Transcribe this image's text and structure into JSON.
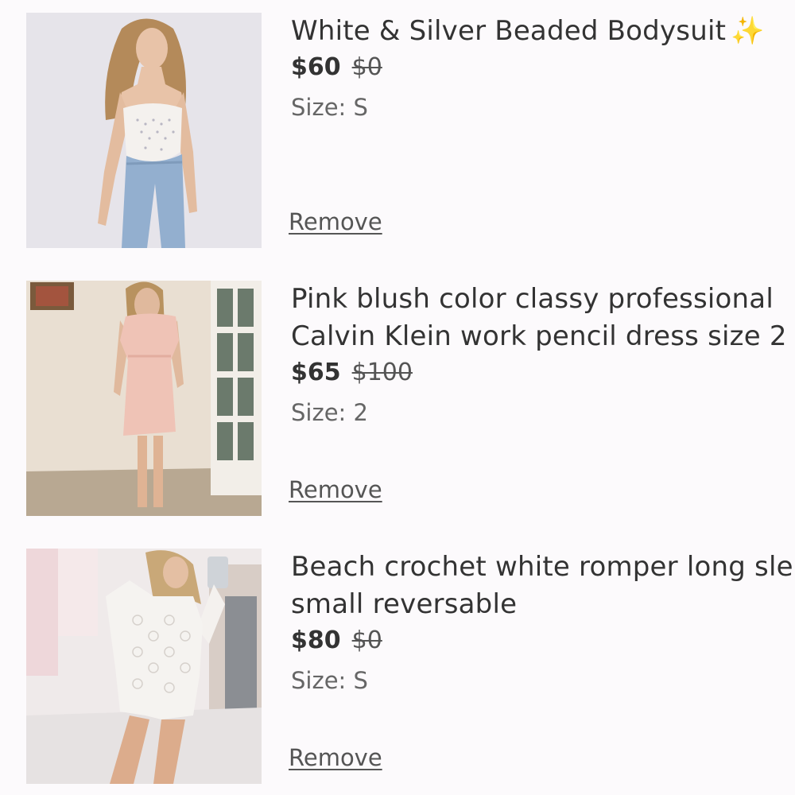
{
  "items": [
    {
      "title": "White & Silver Beaded Bodysuit",
      "emoji": "✨",
      "price": "$60",
      "original_price": "$0",
      "size": "Size: S",
      "remove_label": "Remove"
    },
    {
      "title": "Pink blush color classy professional Calvin Klein work pencil dress size 2",
      "emoji": "",
      "price": "$65",
      "original_price": "$100",
      "size": "Size: 2",
      "remove_label": "Remove"
    },
    {
      "title": "Beach crochet white romper long sle small reversable",
      "emoji": "",
      "price": "$80",
      "original_price": "$0",
      "size": "Size: S",
      "remove_label": "Remove"
    }
  ],
  "colors": {
    "background": "#fcfafc",
    "text": "#333333",
    "muted": "#666666"
  }
}
